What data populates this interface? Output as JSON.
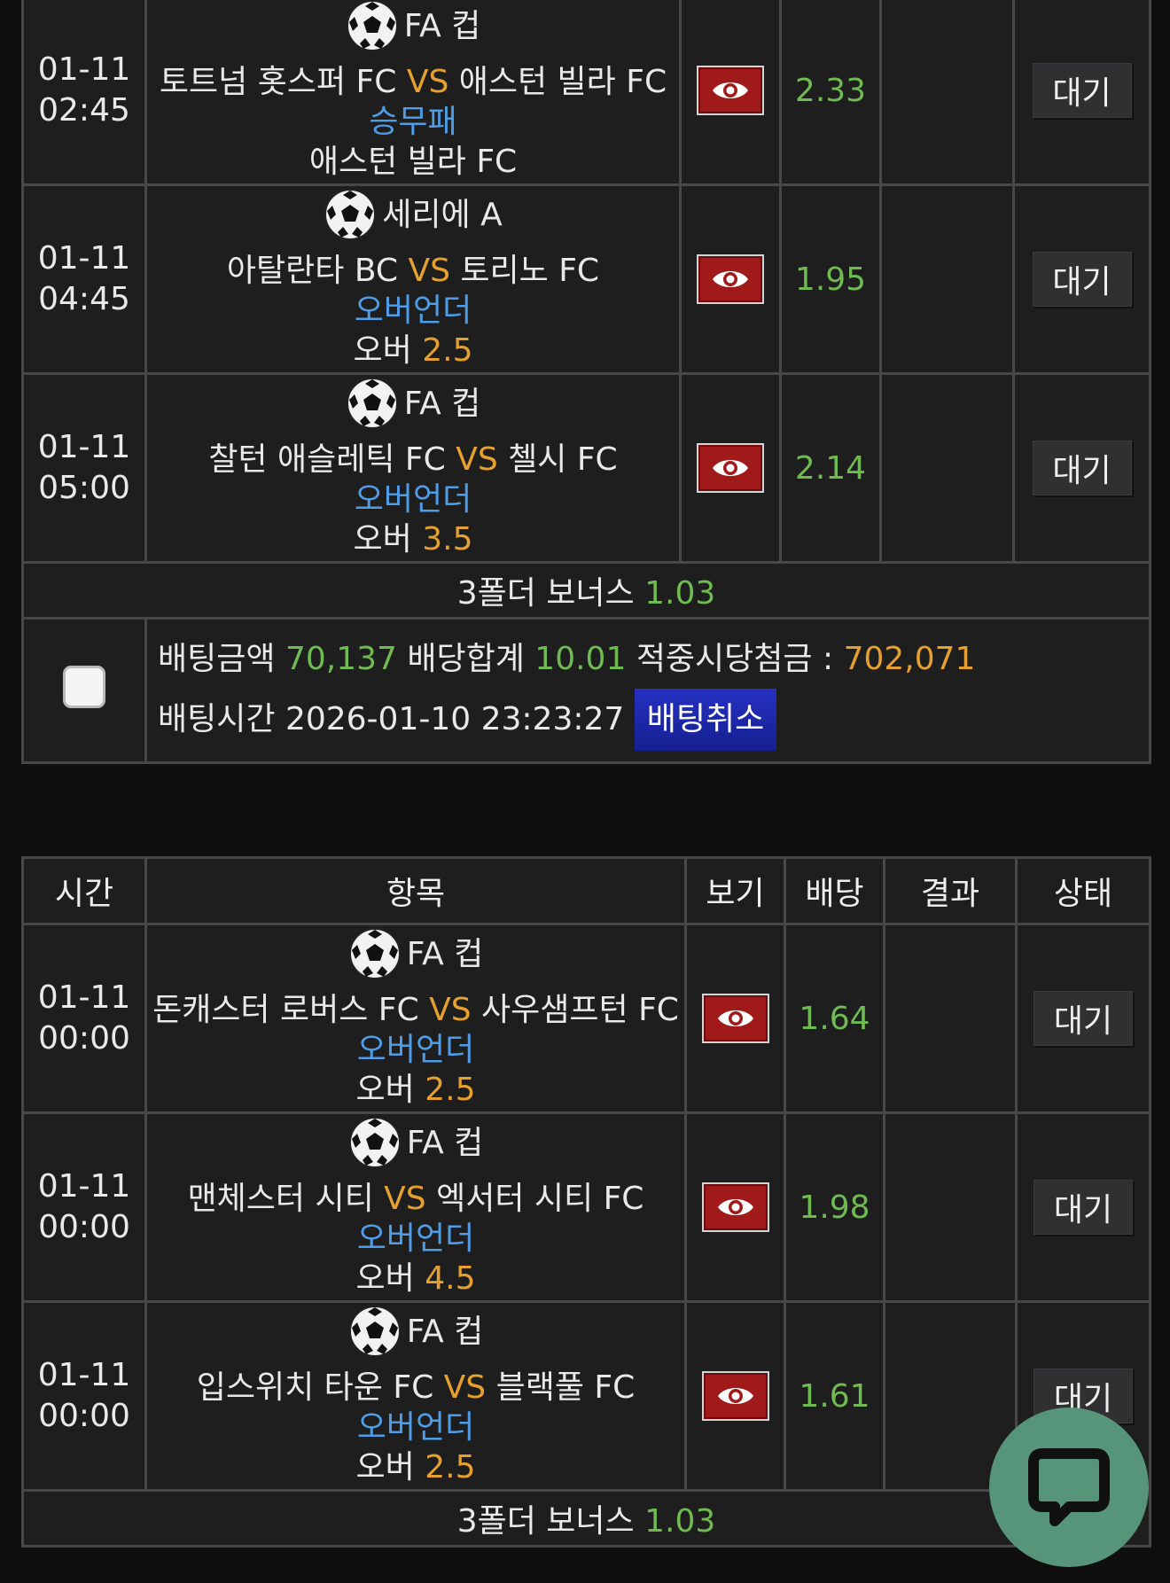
{
  "slip1": {
    "rows": [
      {
        "date": "01-11",
        "time": "02:45",
        "league": "FA 컵",
        "home": "토트넘 홋스퍼 FC",
        "vs": "VS",
        "away": "애스턴 빌라 FC",
        "market": "승무패",
        "pick_text": "애스턴 빌라 FC",
        "pick_value": "",
        "odds": "2.33",
        "result": "",
        "status": "대기"
      },
      {
        "date": "01-11",
        "time": "04:45",
        "league": "세리에 A",
        "home": "아탈란타 BC",
        "vs": "VS",
        "away": "토리노 FC",
        "market": "오버언더",
        "pick_text": "오버",
        "pick_value": "2.5",
        "odds": "1.95",
        "result": "",
        "status": "대기"
      },
      {
        "date": "01-11",
        "time": "05:00",
        "league": "FA 컵",
        "home": "찰턴 애슬레틱 FC",
        "vs": "VS",
        "away": "첼시 FC",
        "market": "오버언더",
        "pick_text": "오버",
        "pick_value": "3.5",
        "odds": "2.14",
        "result": "",
        "status": "대기"
      }
    ],
    "bonus_label": "3폴더 보너스",
    "bonus_value": "1.03",
    "summary": {
      "amount_label": "배팅금액",
      "amount": "70,137",
      "total_odds_label": "배당합계",
      "total_odds": "10.01",
      "payout_label": "적중시당첨금 :",
      "payout": "702,071",
      "time_label": "배팅시간",
      "time": "2026-01-10 23:23:27",
      "cancel_label": "배팅취소"
    }
  },
  "slip2": {
    "headers": {
      "time": "시간",
      "item": "항목",
      "view": "보기",
      "odds": "배당",
      "result": "결과",
      "status": "상태"
    },
    "rows": [
      {
        "date": "01-11",
        "time": "00:00",
        "league": "FA 컵",
        "home": "돈캐스터 로버스 FC",
        "vs": "VS",
        "away": "사우샘프턴 FC",
        "market": "오버언더",
        "pick_text": "오버",
        "pick_value": "2.5",
        "odds": "1.64",
        "result": "",
        "status": "대기"
      },
      {
        "date": "01-11",
        "time": "00:00",
        "league": "FA 컵",
        "home": "맨체스터 시티",
        "vs": "VS",
        "away": "엑서터 시티 FC",
        "market": "오버언더",
        "pick_text": "오버",
        "pick_value": "4.5",
        "odds": "1.98",
        "result": "",
        "status": "대기"
      },
      {
        "date": "01-11",
        "time": "00:00",
        "league": "FA 컵",
        "home": "입스위치 타운 FC",
        "vs": "VS",
        "away": "블랙풀 FC",
        "market": "오버언더",
        "pick_text": "오버",
        "pick_value": "2.5",
        "odds": "1.61",
        "result": "",
        "status": "대기"
      }
    ],
    "bonus_label": "3폴더 보너스",
    "bonus_value": "1.03"
  },
  "icons": {
    "view": "eye-icon",
    "league": "soccer-ball-icon",
    "chat": "chat-icon"
  },
  "colors": {
    "accent_orange": "#e5a02f",
    "pick_blue": "#4f9de6",
    "odds_green": "#6fbb52",
    "view_red": "#a11a1a",
    "cancel_blue": "#1a25a8",
    "chat_green": "#57957a"
  }
}
